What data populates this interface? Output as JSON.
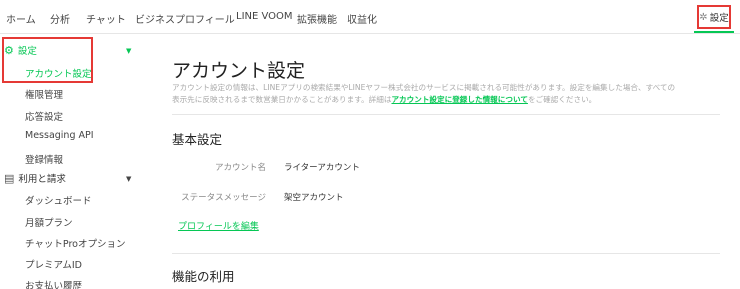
{
  "topnav": {
    "items": [
      "ホーム",
      "分析",
      "チャット",
      "ビジネスプロフィール",
      "LINE VOOM",
      "拡張機能",
      "収益化"
    ],
    "settings_label": "設定"
  },
  "sidebar": {
    "settings_section": "設定",
    "settings_items": [
      "アカウント設定",
      "権限管理",
      "応答設定",
      "Messaging API",
      "登録情報"
    ],
    "billing_section": "利用と請求",
    "billing_items": [
      "ダッシュボード",
      "月額プラン",
      "チャットProオプション",
      "プレミアムID",
      "お支払い履歴"
    ]
  },
  "main": {
    "title": "アカウント設定",
    "desc_line1": "アカウント設定の情報は、LINEアプリの検索結果やLINEヤフー株式会社のサービスに掲載される可能性があります。設定を編集した場合、すべての",
    "desc_line2_a": "表示先に反映されるまで数営業日かかることがあります。詳細は",
    "desc_link": "アカウント設定に登録した情報について",
    "desc_line2_b": "をご確認ください。",
    "basic_title": "基本設定",
    "account_name_label": "アカウント名",
    "account_name_value": "ライターアカウント",
    "status_label": "ステータスメッセージ",
    "status_value": "架空アカウント",
    "edit_profile": "プロフィールを編集",
    "features_title": "機能の利用"
  },
  "colors": {
    "accent": "#06c755",
    "highlight": "#e53935"
  },
  "icons": {
    "settings": "gear-icon",
    "billing": "receipt-icon",
    "caret": "caret-down-icon"
  }
}
